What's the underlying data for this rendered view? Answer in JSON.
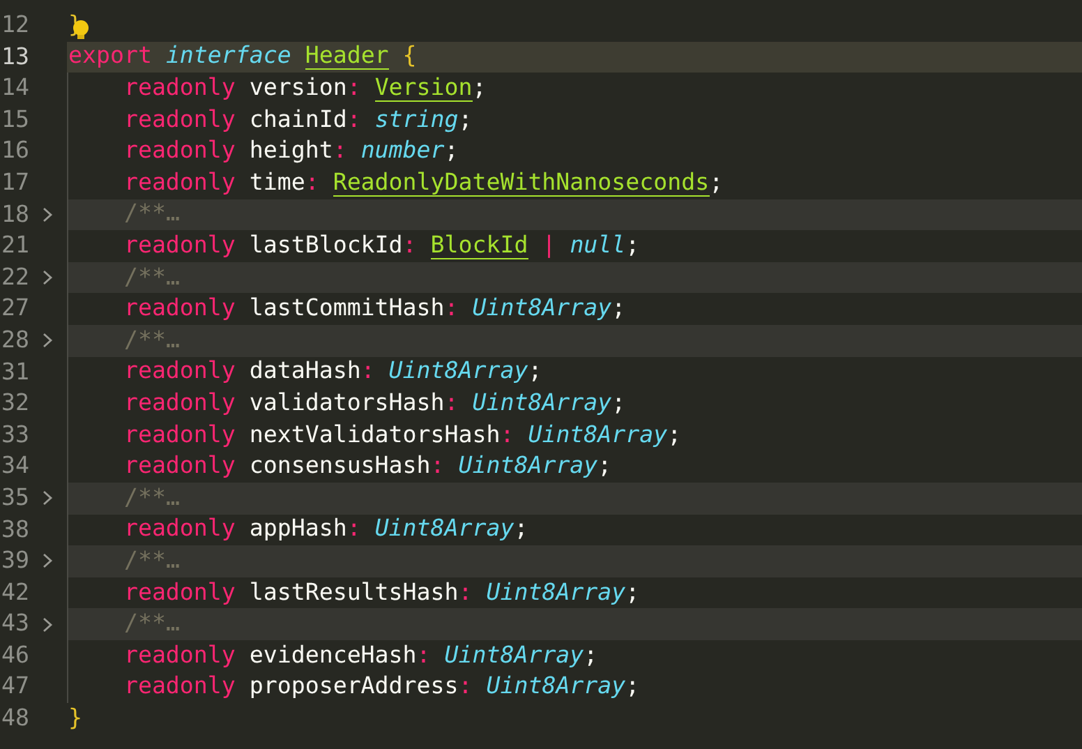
{
  "lines": [
    {
      "number": "12",
      "folded": false,
      "current": false,
      "tokens": [
        {
          "kind": "brace",
          "text": "}"
        }
      ]
    },
    {
      "number": "13",
      "folded": false,
      "current": true,
      "tokens": [
        {
          "kind": "keyword",
          "text": "export"
        },
        {
          "kind": "type",
          "text": " interface "
        },
        {
          "kind": "class",
          "text": "Header",
          "underlined": true
        },
        {
          "kind": "brace",
          "text": " {"
        }
      ]
    },
    {
      "number": "14",
      "folded": false,
      "current": false,
      "tokens": [
        {
          "kind": "keyword",
          "text": "    readonly"
        },
        {
          "kind": "ident",
          "text": " version"
        },
        {
          "kind": "op",
          "text": ": "
        },
        {
          "kind": "class",
          "text": "Version",
          "underlined": true
        },
        {
          "kind": "ident",
          "text": ";"
        }
      ]
    },
    {
      "number": "15",
      "folded": false,
      "current": false,
      "tokens": [
        {
          "kind": "keyword",
          "text": "    readonly"
        },
        {
          "kind": "ident",
          "text": " chainId"
        },
        {
          "kind": "op",
          "text": ":"
        },
        {
          "kind": "type",
          "text": " string"
        },
        {
          "kind": "ident",
          "text": ";"
        }
      ]
    },
    {
      "number": "16",
      "folded": false,
      "current": false,
      "tokens": [
        {
          "kind": "keyword",
          "text": "    readonly"
        },
        {
          "kind": "ident",
          "text": " height"
        },
        {
          "kind": "op",
          "text": ":"
        },
        {
          "kind": "type",
          "text": " number"
        },
        {
          "kind": "ident",
          "text": ";"
        }
      ]
    },
    {
      "number": "17",
      "folded": false,
      "current": false,
      "tokens": [
        {
          "kind": "keyword",
          "text": "    readonly"
        },
        {
          "kind": "ident",
          "text": " time"
        },
        {
          "kind": "op",
          "text": ": "
        },
        {
          "kind": "class",
          "text": "ReadonlyDateWithNanoseconds",
          "underlined": true
        },
        {
          "kind": "ident",
          "text": ";"
        }
      ]
    },
    {
      "number": "18",
      "folded": true,
      "current": false,
      "tokens": [
        {
          "kind": "comment",
          "text": "    /**"
        },
        {
          "kind": "fold",
          "text": "…"
        }
      ]
    },
    {
      "number": "21",
      "folded": false,
      "current": false,
      "tokens": [
        {
          "kind": "keyword",
          "text": "    readonly"
        },
        {
          "kind": "ident",
          "text": " lastBlockId"
        },
        {
          "kind": "op",
          "text": ": "
        },
        {
          "kind": "class",
          "text": "BlockId",
          "underlined": true
        },
        {
          "kind": "op",
          "text": " | "
        },
        {
          "kind": "type",
          "text": "null"
        },
        {
          "kind": "ident",
          "text": ";"
        }
      ]
    },
    {
      "number": "22",
      "folded": true,
      "current": false,
      "tokens": [
        {
          "kind": "comment",
          "text": "    /**"
        },
        {
          "kind": "fold",
          "text": "…"
        }
      ]
    },
    {
      "number": "27",
      "folded": false,
      "current": false,
      "tokens": [
        {
          "kind": "keyword",
          "text": "    readonly"
        },
        {
          "kind": "ident",
          "text": " lastCommitHash"
        },
        {
          "kind": "op",
          "text": ":"
        },
        {
          "kind": "type",
          "text": " Uint8Array"
        },
        {
          "kind": "ident",
          "text": ";"
        }
      ]
    },
    {
      "number": "28",
      "folded": true,
      "current": false,
      "tokens": [
        {
          "kind": "comment",
          "text": "    /**"
        },
        {
          "kind": "fold",
          "text": "…"
        }
      ]
    },
    {
      "number": "31",
      "folded": false,
      "current": false,
      "tokens": [
        {
          "kind": "keyword",
          "text": "    readonly"
        },
        {
          "kind": "ident",
          "text": " dataHash"
        },
        {
          "kind": "op",
          "text": ":"
        },
        {
          "kind": "type",
          "text": " Uint8Array"
        },
        {
          "kind": "ident",
          "text": ";"
        }
      ]
    },
    {
      "number": "32",
      "folded": false,
      "current": false,
      "tokens": [
        {
          "kind": "keyword",
          "text": "    readonly"
        },
        {
          "kind": "ident",
          "text": " validatorsHash"
        },
        {
          "kind": "op",
          "text": ":"
        },
        {
          "kind": "type",
          "text": " Uint8Array"
        },
        {
          "kind": "ident",
          "text": ";"
        }
      ]
    },
    {
      "number": "33",
      "folded": false,
      "current": false,
      "tokens": [
        {
          "kind": "keyword",
          "text": "    readonly"
        },
        {
          "kind": "ident",
          "text": " nextValidatorsHash"
        },
        {
          "kind": "op",
          "text": ":"
        },
        {
          "kind": "type",
          "text": " Uint8Array"
        },
        {
          "kind": "ident",
          "text": ";"
        }
      ]
    },
    {
      "number": "34",
      "folded": false,
      "current": false,
      "tokens": [
        {
          "kind": "keyword",
          "text": "    readonly"
        },
        {
          "kind": "ident",
          "text": " consensusHash"
        },
        {
          "kind": "op",
          "text": ":"
        },
        {
          "kind": "type",
          "text": " Uint8Array"
        },
        {
          "kind": "ident",
          "text": ";"
        }
      ]
    },
    {
      "number": "35",
      "folded": true,
      "current": false,
      "tokens": [
        {
          "kind": "comment",
          "text": "    /**"
        },
        {
          "kind": "fold",
          "text": "…"
        }
      ]
    },
    {
      "number": "38",
      "folded": false,
      "current": false,
      "tokens": [
        {
          "kind": "keyword",
          "text": "    readonly"
        },
        {
          "kind": "ident",
          "text": " appHash"
        },
        {
          "kind": "op",
          "text": ":"
        },
        {
          "kind": "type",
          "text": " Uint8Array"
        },
        {
          "kind": "ident",
          "text": ";"
        }
      ]
    },
    {
      "number": "39",
      "folded": true,
      "current": false,
      "tokens": [
        {
          "kind": "comment",
          "text": "    /**"
        },
        {
          "kind": "fold",
          "text": "…"
        }
      ]
    },
    {
      "number": "42",
      "folded": false,
      "current": false,
      "tokens": [
        {
          "kind": "keyword",
          "text": "    readonly"
        },
        {
          "kind": "ident",
          "text": " lastResultsHash"
        },
        {
          "kind": "op",
          "text": ":"
        },
        {
          "kind": "type",
          "text": " Uint8Array"
        },
        {
          "kind": "ident",
          "text": ";"
        }
      ]
    },
    {
      "number": "43",
      "folded": true,
      "current": false,
      "tokens": [
        {
          "kind": "comment",
          "text": "    /**"
        },
        {
          "kind": "fold",
          "text": "…"
        }
      ]
    },
    {
      "number": "46",
      "folded": false,
      "current": false,
      "tokens": [
        {
          "kind": "keyword",
          "text": "    readonly"
        },
        {
          "kind": "ident",
          "text": " evidenceHash"
        },
        {
          "kind": "op",
          "text": ":"
        },
        {
          "kind": "type",
          "text": " Uint8Array"
        },
        {
          "kind": "ident",
          "text": ";"
        }
      ]
    },
    {
      "number": "47",
      "folded": false,
      "current": false,
      "tokens": [
        {
          "kind": "keyword",
          "text": "    readonly"
        },
        {
          "kind": "ident",
          "text": " proposerAddress"
        },
        {
          "kind": "op",
          "text": ":"
        },
        {
          "kind": "type",
          "text": " Uint8Array"
        },
        {
          "kind": "ident",
          "text": ";"
        }
      ]
    },
    {
      "number": "48",
      "folded": false,
      "current": false,
      "tokens": [
        {
          "kind": "brace",
          "text": "}"
        }
      ]
    }
  ]
}
